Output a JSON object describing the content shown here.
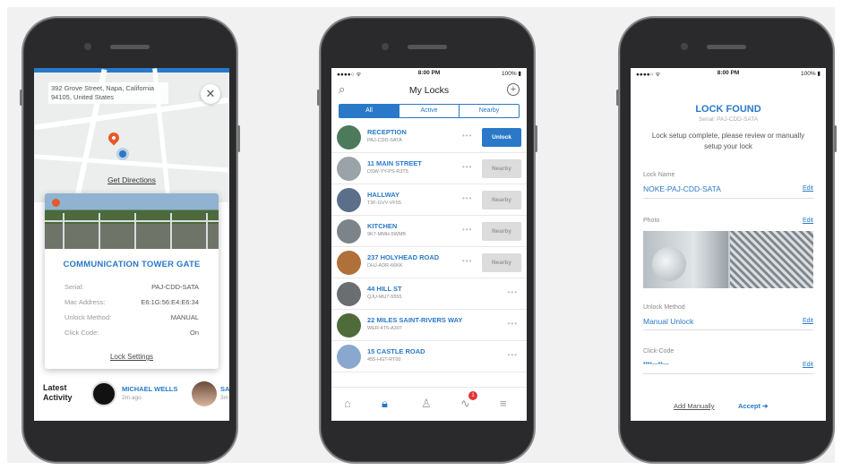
{
  "phone1": {
    "address": "392 Grove Street, Napa, California 94105, United States",
    "close_icon": "close-icon",
    "get_directions": "Get Directions",
    "lock_name": "COMMUNICATION TOWER GATE",
    "details": [
      {
        "label": "Serial:",
        "value": "PAJ-CDD-SATA"
      },
      {
        "label": "Mac Address:",
        "value": "E6:1G:56:E4:E6:34"
      },
      {
        "label": "Unlock Method:",
        "value": "MANUAL"
      },
      {
        "label": "Click Code:",
        "value": "On"
      }
    ],
    "lock_settings": "Lock Settings",
    "latest_activity_label": "Latest Activity",
    "activity": [
      {
        "name": "MICHAEL WELLS",
        "time": "2m ago"
      },
      {
        "name": "SA",
        "time": "3m"
      }
    ]
  },
  "phone2": {
    "status_left": "●●●●○ ᯤ",
    "status_time": "8:00 PM",
    "status_right": "100% ▮",
    "title": "My Locks",
    "tabs": [
      "All",
      "Active",
      "Nearby"
    ],
    "active_tab": 0,
    "locks": [
      {
        "name": "RECEPTION",
        "serial": "PAJ-CDD-SATA",
        "action": "Unlock",
        "style": "blue"
      },
      {
        "name": "11 MAIN STREET",
        "serial": "DSW-YY-PS-R3T5",
        "action": "Nearby",
        "style": "grey"
      },
      {
        "name": "HALLWAY",
        "serial": "T3F-GVV-VF55",
        "action": "Nearby",
        "style": "grey"
      },
      {
        "name": "KITCHEN",
        "serial": "9K7-MMH-5WMB",
        "action": "Nearby",
        "style": "grey"
      },
      {
        "name": "237 HOLYHEAD ROAD",
        "serial": "DHJ-ADR-66KK",
        "action": "Nearby",
        "style": "grey"
      },
      {
        "name": "44 HILL ST",
        "serial": "QJU-MU7-5555",
        "action": "",
        "style": "none"
      },
      {
        "name": "22 MILES SAINT-RIVERS WAY",
        "serial": "WER-4T5-A307",
        "action": "",
        "style": "none"
      },
      {
        "name": "15 CASTLE ROAD",
        "serial": "455-HGT-RT00",
        "action": "",
        "style": "none"
      }
    ],
    "tab_icons": [
      "home-icon",
      "lock-icon",
      "user-icon",
      "activity-icon",
      "menu-icon"
    ],
    "badge_count": "1"
  },
  "phone3": {
    "status_left": "●●●●○ ᯤ",
    "status_time": "8:00 PM",
    "status_right": "100% ▮",
    "title": "LOCK FOUND",
    "serial": "Serial: PAJ-CDD-SATA",
    "message": "Lock setup complete, please review or manually setup your lock",
    "lock_name_label": "Lock Name",
    "lock_name_value": "NOKE-PAJ-CDD-SATA",
    "photo_label": "Photo",
    "unlock_method_label": "Unlock Method",
    "unlock_method_value": "Manual Unlock",
    "click_code_label": "Click-Code",
    "click_code_value": "••••—••—",
    "edit": "Edit",
    "add_manually": "Add Manually",
    "accept": "Accept"
  },
  "colors": {
    "accent": "#2a79c8",
    "pin": "#e45a2b",
    "badge": "#e03434"
  }
}
